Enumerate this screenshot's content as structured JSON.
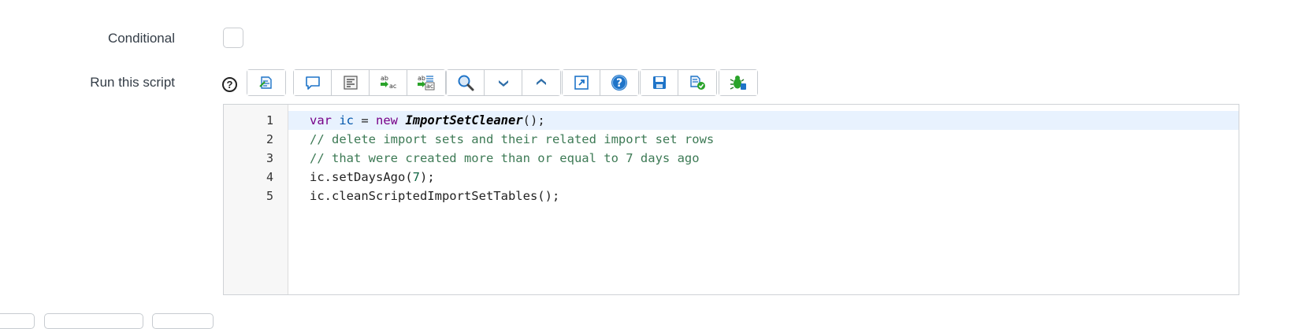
{
  "form": {
    "conditional_label": "Conditional",
    "run_script_label": "Run this script",
    "help_glyph": "?"
  },
  "toolbar": {
    "groups": [
      [
        "format-code-icon"
      ],
      [
        "comment-icon",
        "format-icon",
        "replace-icon",
        "replace-all-icon"
      ],
      [
        "search-icon",
        "next-icon",
        "previous-icon"
      ],
      [
        "fullscreen-icon",
        "help-icon"
      ],
      [
        "save-icon",
        "syntax-check-icon"
      ],
      [
        "debug-icon"
      ]
    ]
  },
  "editor": {
    "line_numbers": [
      "1",
      "2",
      "3",
      "4",
      "5"
    ],
    "lines": {
      "l1": {
        "kw1": "var",
        "var1": "ic",
        "op": " = ",
        "kw2": "new",
        "cls": "ImportSetCleaner",
        "rest": "();"
      },
      "l2": "// delete import sets and their related import set rows",
      "l3": "// that were created more than or equal to 7 days ago",
      "l4": {
        "pre": "ic.setDaysAgo(",
        "num": "7",
        "post": ");"
      },
      "l5": "ic.cleanScriptedImportSetTables();"
    }
  },
  "colors": {
    "keyword": "#770088",
    "comment": "#3d7a55",
    "active_line": "#e8f2fe",
    "icon_blue": "#1f74c8",
    "icon_green": "#2aa32a"
  }
}
